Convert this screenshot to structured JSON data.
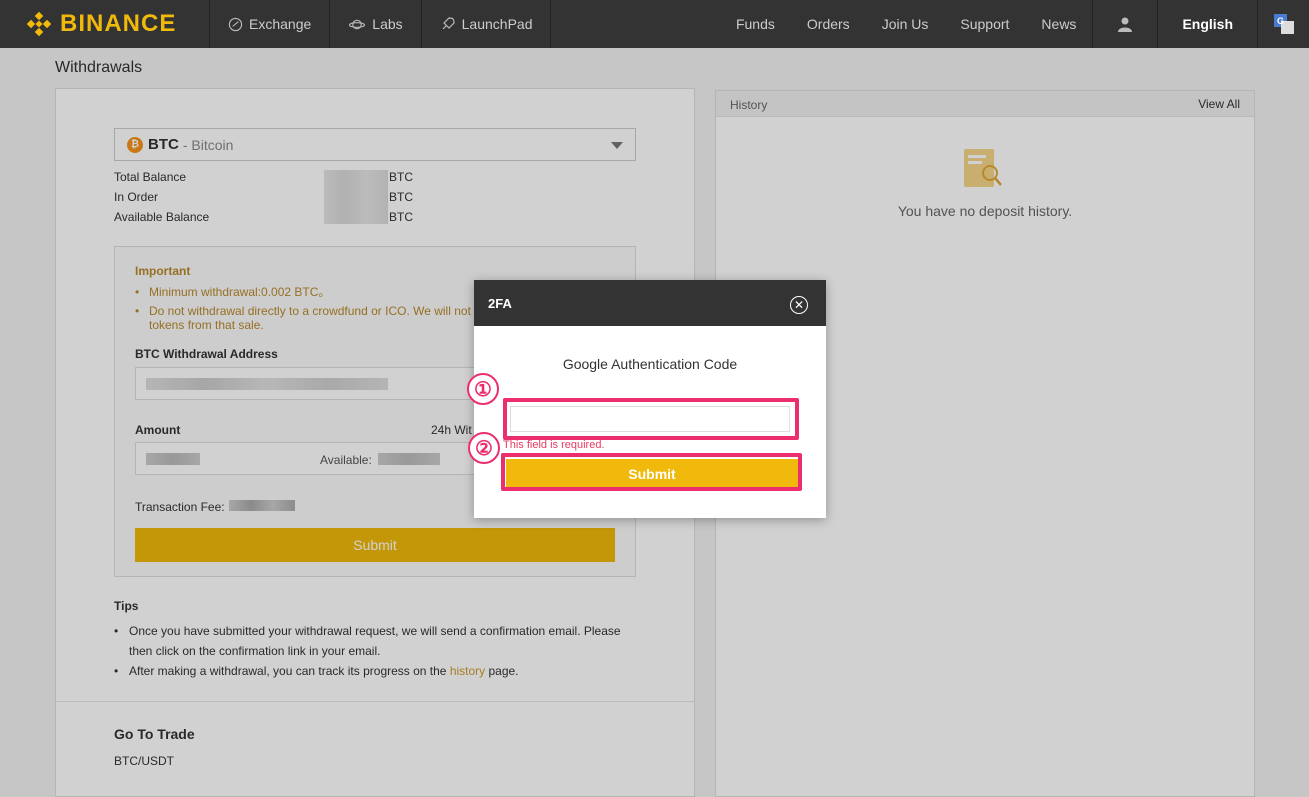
{
  "nav": {
    "brand": "BINANCE",
    "items": [
      {
        "label": "Exchange",
        "icon": "exchange-icon"
      },
      {
        "label": "Labs",
        "icon": "planet-icon"
      },
      {
        "label": "LaunchPad",
        "icon": "rocket-icon"
      }
    ],
    "right": [
      "Funds",
      "Orders",
      "Join Us",
      "Support",
      "News"
    ],
    "language": "English"
  },
  "page": {
    "title": "Withdrawals"
  },
  "coin": {
    "symbol": "BTC",
    "name": "- Bitcoin",
    "icon_letter": "₿"
  },
  "balances": {
    "total_label": "Total Balance",
    "in_order_label": "In Order",
    "available_label": "Available Balance",
    "unit": "BTC"
  },
  "important": {
    "title": "Important",
    "items": [
      "Minimum withdrawal:0.002 BTC。",
      "Do not withdrawal directly to a crowdfund or ICO. We will not tokens from that sale."
    ]
  },
  "form": {
    "address_label": "BTC Withdrawal Address",
    "amount_label": "Amount",
    "limit_label": "24h Wit",
    "available_label": "Available:",
    "fee_label": "Transaction Fee:",
    "submit_label": "Submit"
  },
  "tips": {
    "title": "Tips",
    "item1": "Once you have submitted your withdrawal request, we will send a confirmation email. Please then click on the confirmation link in your email.",
    "item2_pre": "After making a withdrawal, you can track its progress on the ",
    "item2_link": "history",
    "item2_post": " page."
  },
  "trade": {
    "title": "Go To Trade",
    "pair": "BTC/USDT"
  },
  "history": {
    "title": "History",
    "view_all": "View All",
    "empty": "You have no deposit history."
  },
  "modal": {
    "title": "2FA",
    "label": "Google Authentication Code",
    "input_value": "",
    "error": "This field is required.",
    "submit_label": "Submit"
  },
  "annotations": {
    "marker1": "①",
    "marker2": "②"
  },
  "colors": {
    "brand": "#f0b90b",
    "highlight": "#ec2f6c",
    "error": "#e53b5f"
  }
}
